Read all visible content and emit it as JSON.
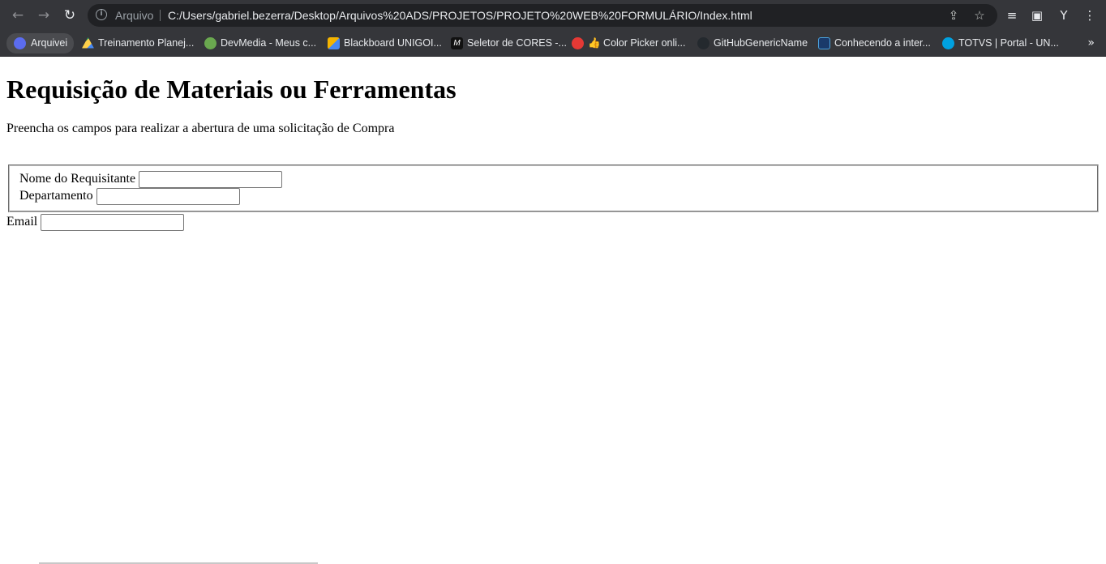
{
  "browser": {
    "scheme_label": "Arquivo",
    "url": "C:/Users/gabriel.bezerra/Desktop/Arquivos%20ADS/PROJETOS/PROJETO%20WEB%20FORMULÁRIO/Index.html",
    "icons": [
      "back-arrow",
      "forward-arrow",
      "reload",
      "info",
      "share",
      "star",
      "reading-list",
      "side-panel",
      "extension",
      "menu"
    ]
  },
  "bookmarks": {
    "items": [
      {
        "label": "Arquivei",
        "color": "#5b6cf0"
      },
      {
        "label": "Treinamento Planej...",
        "color": "#1fa463"
      },
      {
        "label": "DevMedia - Meus c...",
        "color": "#6aa84f"
      },
      {
        "label": "Blackboard UNIGOI...",
        "color": "#f4b400"
      },
      {
        "label": "Seletor de CORES -...",
        "color": "#111111"
      },
      {
        "label": "👍 Color Picker onli...",
        "color": "#e53935"
      },
      {
        "label": "GitHubGenericName",
        "color": "#24292e"
      },
      {
        "label": "Conhecendo a inter...",
        "color": "#1a73e8"
      },
      {
        "label": "TOTVS | Portal - UN...",
        "color": "#00a1e0"
      }
    ],
    "more": "»"
  },
  "page": {
    "title": "Requisição de Materiais ou Ferramentas",
    "subtitle": "Preencha os campos para realizar a abertura de uma solicitação de Compra",
    "form": {
      "nome_label": "Nome do Requisitante",
      "nome_value": "",
      "departamento_label": "Departamento",
      "departamento_value": "",
      "email_label": "Email",
      "email_value": ""
    }
  }
}
